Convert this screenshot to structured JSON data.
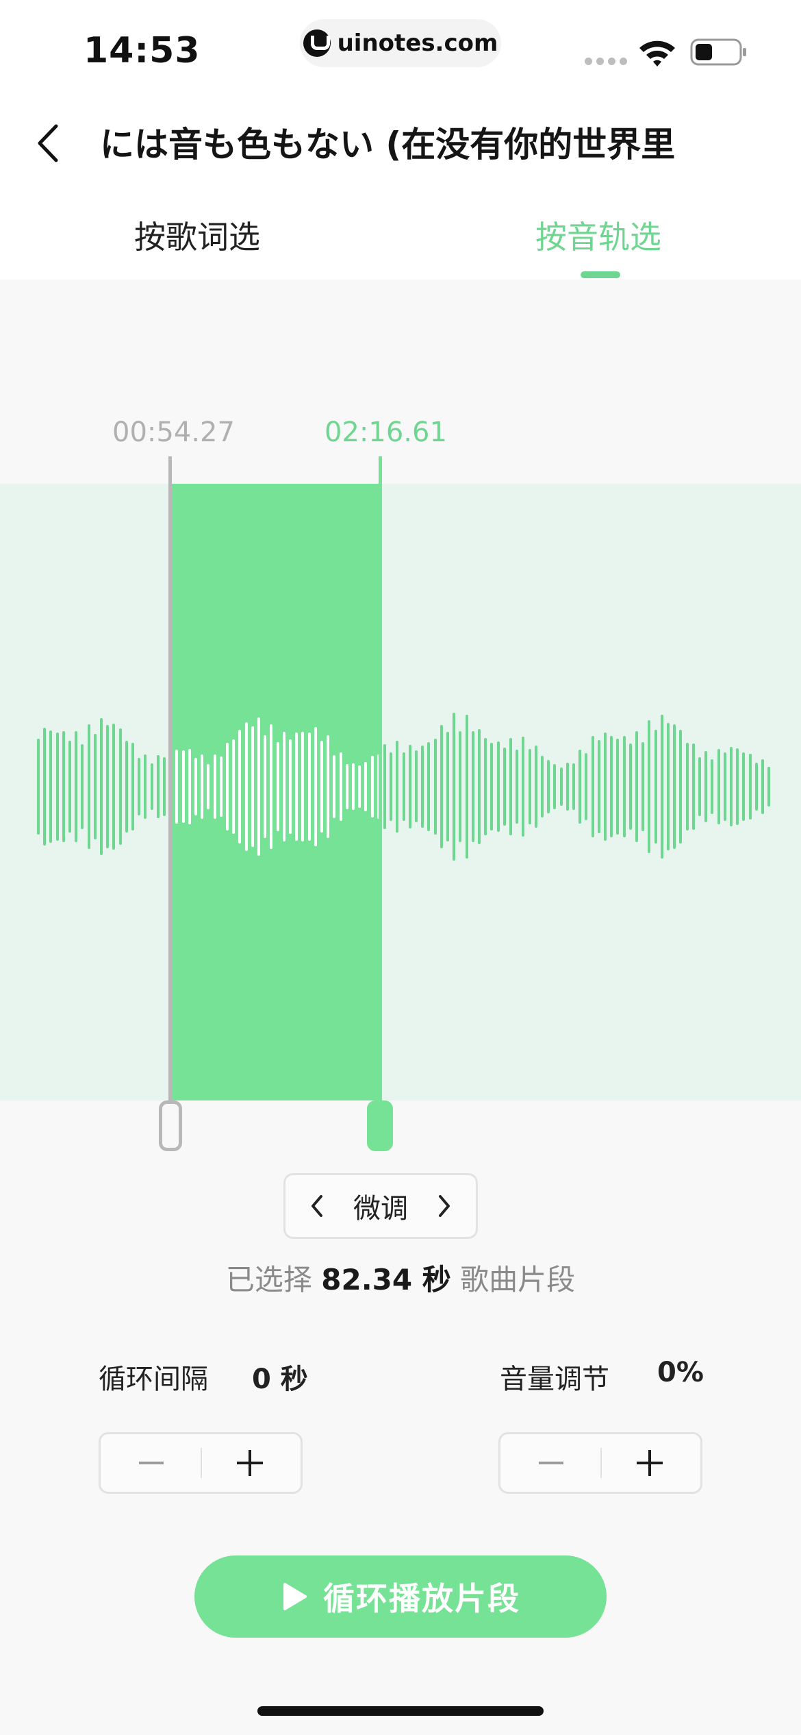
{
  "status_bar": {
    "time": "14:53",
    "url": "uinotes.com",
    "icons": [
      "signal-icon",
      "wifi-icon",
      "battery-icon"
    ]
  },
  "nav": {
    "back_icon": "chevron-left-icon",
    "title": "には音も色もない (在没有你的世界里"
  },
  "tabs": [
    {
      "label": "按歌词选",
      "active": false
    },
    {
      "label": "按音轨选",
      "active": true
    }
  ],
  "waveform": {
    "start_time": "00:54.27",
    "end_time": "02:16.61"
  },
  "fine_tune": {
    "label": "微调",
    "prev_icon": "chevron-left-icon",
    "next_icon": "chevron-right-icon"
  },
  "selection_info": {
    "prefix": "已选择",
    "value": "82.34 秒",
    "suffix": "歌曲片段"
  },
  "loop_interval": {
    "label": "循环间隔",
    "value": "0 秒"
  },
  "volume": {
    "label": "音量调节",
    "value": "0%"
  },
  "play_button": {
    "label": "循环播放片段",
    "icon": "play-icon"
  },
  "colors": {
    "accent": "#76e295",
    "accent_text": "#6fd691",
    "wave_bg": "#e8f5ef",
    "muted": "#b0b0b0"
  }
}
